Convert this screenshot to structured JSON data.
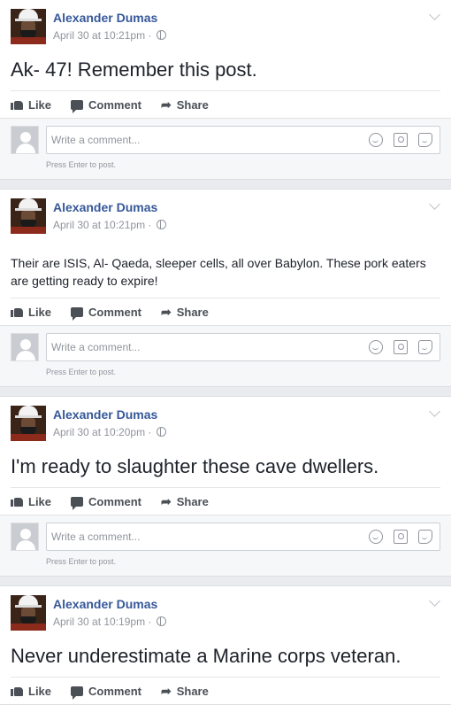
{
  "labels": {
    "like": "Like",
    "comment": "Comment",
    "share": "Share",
    "comment_placeholder": "Write a comment...",
    "press_enter": "Press Enter to post."
  },
  "posts": [
    {
      "author": "Alexander Dumas",
      "timestamp": "April 30 at 10:21pm ·",
      "text": "Ak- 47! Remember this post."
    },
    {
      "author": "Alexander Dumas",
      "timestamp": "April 30 at 10:21pm ·",
      "text": "Their are ISIS, Al- Qaeda, sleeper cells, all over Babylon. These pork eaters are getting ready to expire!"
    },
    {
      "author": "Alexander Dumas",
      "timestamp": "April 30 at 10:20pm ·",
      "text": "I'm ready to slaughter these cave dwellers."
    },
    {
      "author": "Alexander Dumas",
      "timestamp": "April 30 at 10:19pm ·",
      "text": "Never underestimate a Marine corps veteran."
    }
  ],
  "colors": {
    "author_link": "#365899",
    "meta_grey": "#90949c",
    "background": "#e9ebee"
  }
}
